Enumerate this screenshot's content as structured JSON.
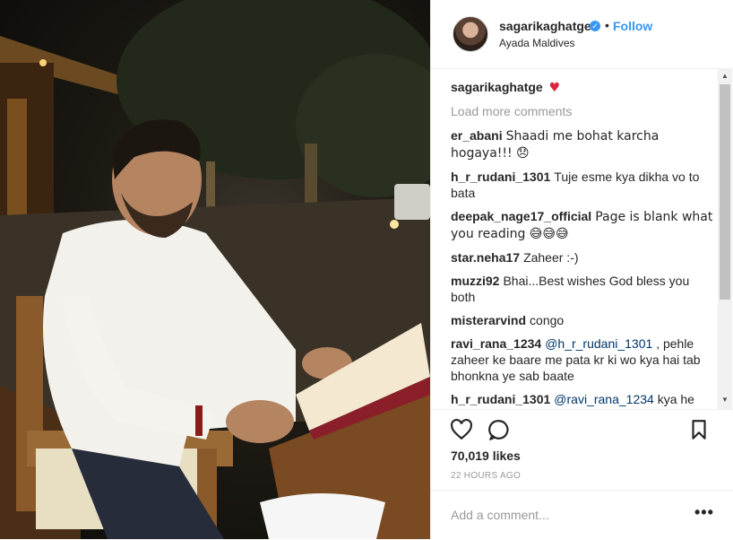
{
  "post": {
    "username": "sagarikaghatge",
    "follow_label": "Follow",
    "separator": "•",
    "location": "Ayada Maldives",
    "caption_user": "sagarikaghatge",
    "caption_emoji": "♥"
  },
  "comments": {
    "load_more": "Load more comments",
    "items": [
      {
        "user": "er_abani",
        "text": "Shaadi me bohat karcha hogaya!!! 😞"
      },
      {
        "user": "h_r_rudani_1301",
        "text": "Tuje esme kya dikha vo to bata"
      },
      {
        "user": "deepak_nage17_official",
        "text": "Page is blank what you reading 😅😅😅"
      },
      {
        "user": "star.neha17",
        "text": "Zaheer :-)"
      },
      {
        "user": "muzzi92",
        "text": "Bhai...Best wishes God bless you both"
      },
      {
        "user": "misterarvind",
        "text": "congo"
      },
      {
        "user": "ravi_rana_1234",
        "mention": "@h_r_rudani_1301",
        "text": ", pehle zaheer ke baare me pata kr ki wo kya hai tab bhonkna ye sab baate"
      },
      {
        "user": "h_r_rudani_1301",
        "mention": "@ravi_rana_1234",
        "text": "kya he batana"
      }
    ]
  },
  "stats": {
    "likes": "70,019 likes",
    "time": "22 HOURS AGO"
  },
  "comment_box": {
    "placeholder": "Add a comment...",
    "more": "•••"
  },
  "colors": {
    "accent": "#3897f0",
    "muted": "#999999",
    "border": "#efefef"
  },
  "icons": [
    "verified-icon",
    "heart-icon",
    "comment-icon",
    "bookmark-icon",
    "more-options-icon"
  ]
}
